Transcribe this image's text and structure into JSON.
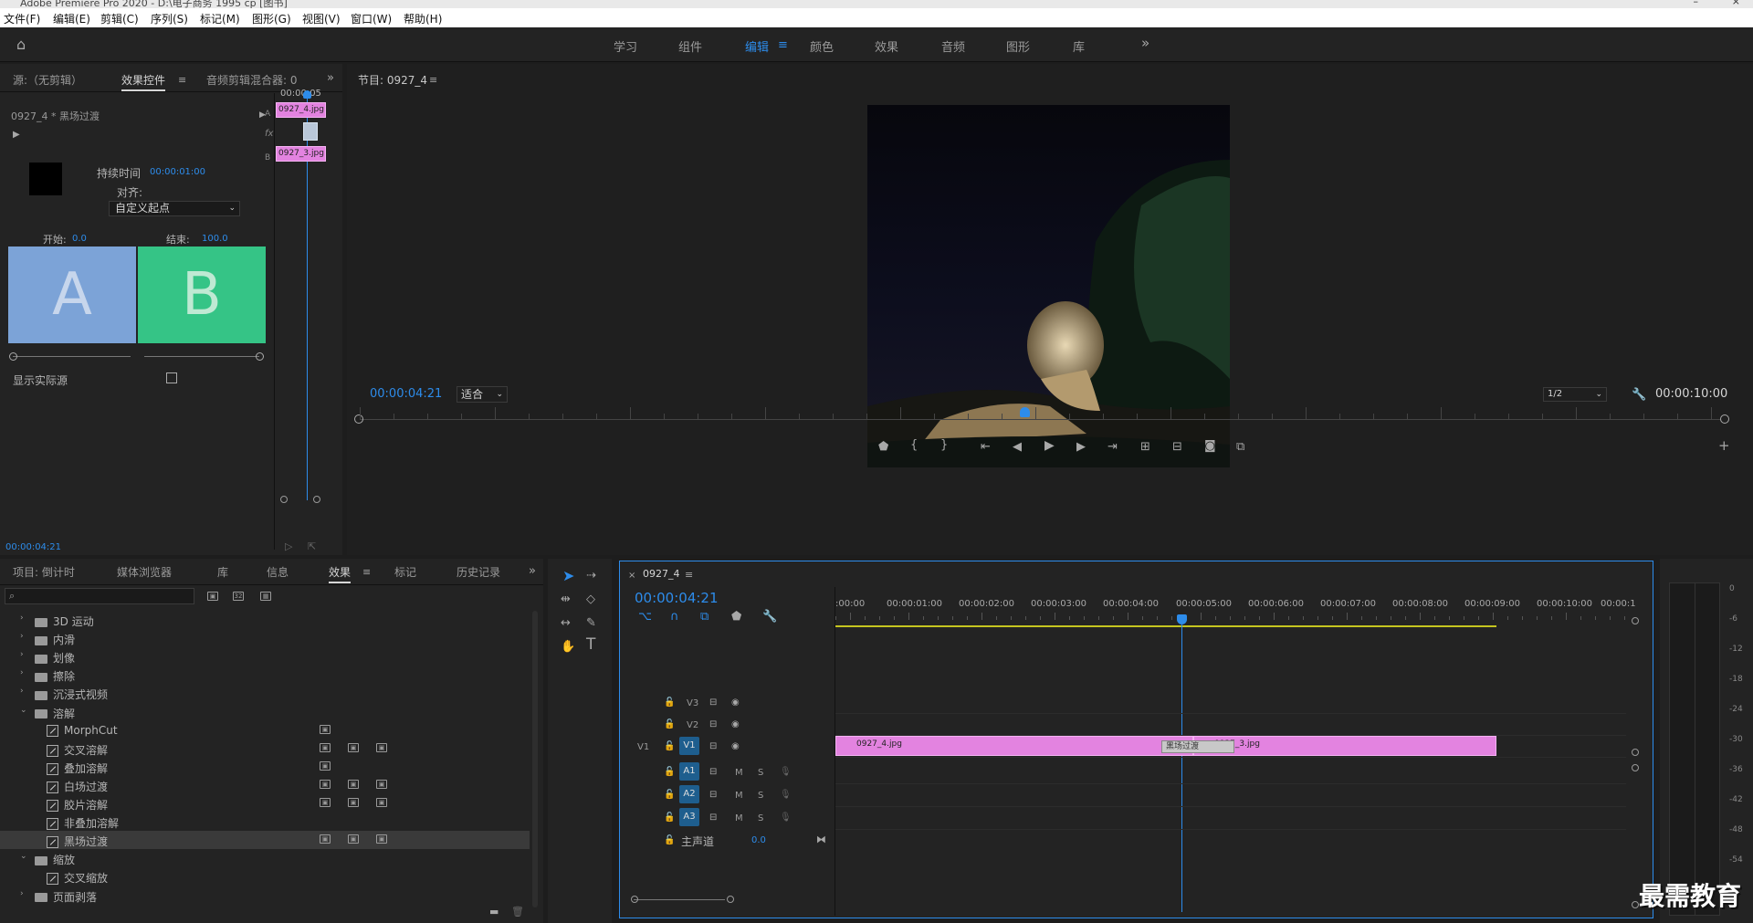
{
  "window": {
    "title": "Adobe Premiere Pro 2020 - D:\\电子商务 1995 cp [图书]"
  },
  "menu": [
    "文件(F)",
    "编辑(E)",
    "剪辑(C)",
    "序列(S)",
    "标记(M)",
    "图形(G)",
    "视图(V)",
    "窗口(W)",
    "帮助(H)"
  ],
  "workspaces": [
    "学习",
    "组件",
    "编辑",
    "颜色",
    "效果",
    "音频",
    "图形",
    "库"
  ],
  "workspaces_active": "编辑",
  "source_panel": {
    "tabs": [
      "源:（无剪辑）",
      "效果控件",
      "音频剪辑混合器: 0"
    ],
    "clip_title": "0927_4 * 黑场过渡",
    "duration_label": "持续时间",
    "duration_value": "00:00:01:00",
    "align_label": "对齐:",
    "align_value": "自定义起点",
    "start_label": "开始:",
    "start_value": "0.0",
    "end_label": "结束:",
    "end_value": "100.0",
    "a_letter": "A",
    "b_letter": "B",
    "show_source_label": "显示实际源",
    "timecode": "00:00:04:21",
    "mini_time": "00:00:05",
    "mini_clip_a": "0927_4.jpg",
    "mini_clip_b": "0927_3.jpg",
    "mini_a": "A",
    "mini_b": "B",
    "mini_fx": "fx"
  },
  "program_panel": {
    "tab": "节目: 0927_4",
    "timecode": "00:00:04:21",
    "fit": "适合",
    "quality": "1/2",
    "duration": "00:00:10:00"
  },
  "project_panel": {
    "tabs": [
      "项目: 倒计时",
      "媒体浏览器",
      "库",
      "信息",
      "效果",
      "标记",
      "历史记录"
    ],
    "active_tab": "效果",
    "search_placeholder": "",
    "tree": [
      {
        "type": "folder",
        "label": "3D 运动",
        "open": false,
        "indent": 0
      },
      {
        "type": "folder",
        "label": "内滑",
        "open": false,
        "indent": 0
      },
      {
        "type": "folder",
        "label": "划像",
        "open": false,
        "indent": 0
      },
      {
        "type": "folder",
        "label": "擦除",
        "open": false,
        "indent": 0
      },
      {
        "type": "folder",
        "label": "沉浸式视频",
        "open": false,
        "indent": 0
      },
      {
        "type": "folder",
        "label": "溶解",
        "open": true,
        "indent": 0
      },
      {
        "type": "fx",
        "label": "MorphCut",
        "indent": 1,
        "badges": 1
      },
      {
        "type": "fx",
        "label": "交叉溶解",
        "indent": 1,
        "badges": 3
      },
      {
        "type": "fx",
        "label": "叠加溶解",
        "indent": 1,
        "badges": 1
      },
      {
        "type": "fx",
        "label": "白场过渡",
        "indent": 1,
        "badges": 3
      },
      {
        "type": "fx",
        "label": "胶片溶解",
        "indent": 1,
        "badges": 3
      },
      {
        "type": "fx",
        "label": "非叠加溶解",
        "indent": 1,
        "badges": 0
      },
      {
        "type": "fx",
        "label": "黑场过渡",
        "indent": 1,
        "badges": 3,
        "selected": true
      },
      {
        "type": "folder",
        "label": "缩放",
        "open": true,
        "indent": 0
      },
      {
        "type": "fx",
        "label": "交叉缩放",
        "indent": 1,
        "badges": 0
      },
      {
        "type": "folder",
        "label": "页面剥落",
        "open": false,
        "indent": 0
      }
    ]
  },
  "timeline": {
    "tab": "0927_4",
    "timecode": "00:00:04:21",
    "ruler": [
      ":00:00",
      "00:00:01:00",
      "00:00:02:00",
      "00:00:03:00",
      "00:00:04:00",
      "00:00:05:00",
      "00:00:06:00",
      "00:00:07:00",
      "00:00:08:00",
      "00:00:09:00",
      "00:00:10:00",
      "00:00:1"
    ],
    "video_tracks": [
      "V3",
      "V2",
      "V1"
    ],
    "audio_tracks": [
      "A1",
      "A2",
      "A3"
    ],
    "source_v1": "V1",
    "master_label": "主声道",
    "master_value": "0.0",
    "clip_a": "0927_4.jpg",
    "clip_b": "0927_3.jpg",
    "transition": "黑场过渡",
    "m_label": "M",
    "s_label": "S"
  },
  "meter": {
    "labels": [
      "0",
      "-6",
      "-12",
      "-18",
      "-24",
      "-30",
      "-36",
      "-42",
      "-48",
      "-54"
    ]
  },
  "watermark": "最需教育"
}
